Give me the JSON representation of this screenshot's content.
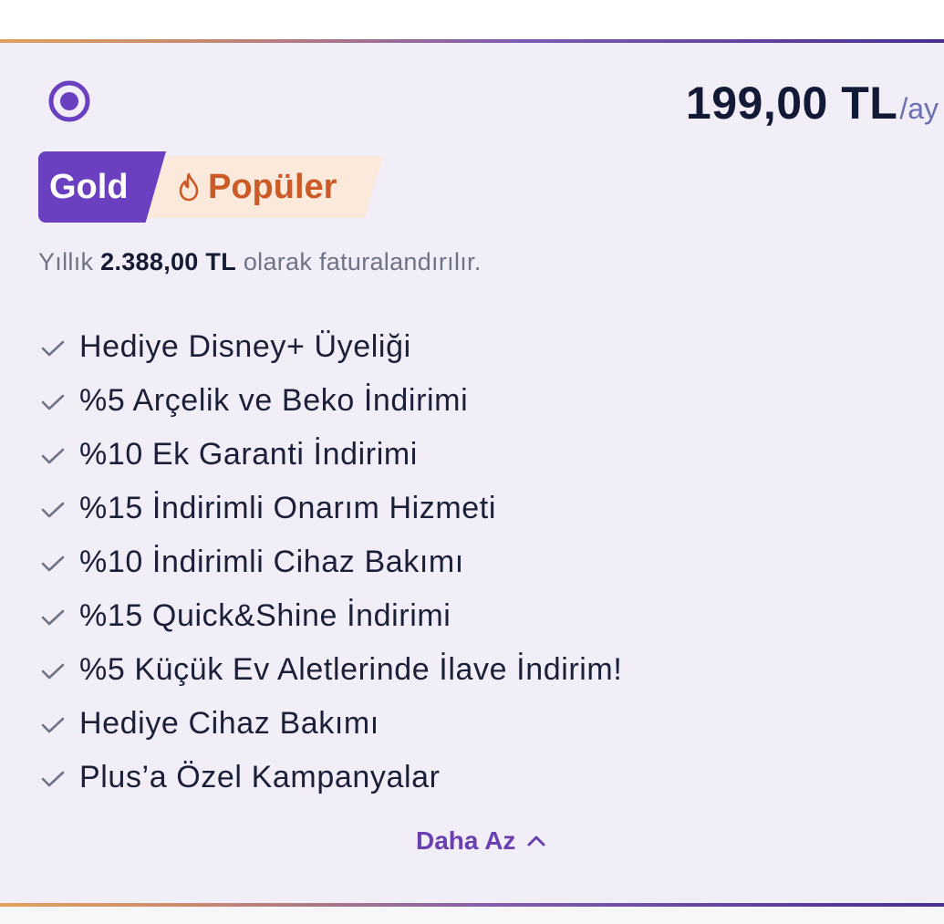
{
  "plan": {
    "price_amount": "199,00 TL",
    "price_period": "/ay",
    "tier_badge": "Gold",
    "popular_badge": "Popüler",
    "billing": {
      "prefix": "Yıllık",
      "amount": "2.388,00 TL",
      "suffix": "olarak faturalandırılır."
    },
    "features": [
      "Hediye Disney+ Üyeliği",
      "%5 Arçelik ve Beko İndirimi",
      "%10 Ek Garanti İndirimi",
      "%15 İndirimli Onarım Hizmeti",
      "%10 İndirimli Cihaz Bakımı",
      "%15 Quick&Shine İndirimi",
      "%5 Küçük Ev Aletlerinde İlave İndirim!",
      "Hediye Cihaz Bakımı",
      "Plus’a Özel Kampanyalar"
    ],
    "toggle_label": "Daha Az",
    "selected": true
  },
  "icons": {
    "radio": "radio-selected-icon",
    "flame": "flame-icon",
    "check": "check-icon",
    "chevron": "chevron-up-icon"
  },
  "colors": {
    "accent_purple": "#6a3fc0",
    "popular_orange": "#cc5a26",
    "popular_bg": "#fbeadc",
    "card_bg": "#f2eef8",
    "text_dark": "#121a36"
  }
}
